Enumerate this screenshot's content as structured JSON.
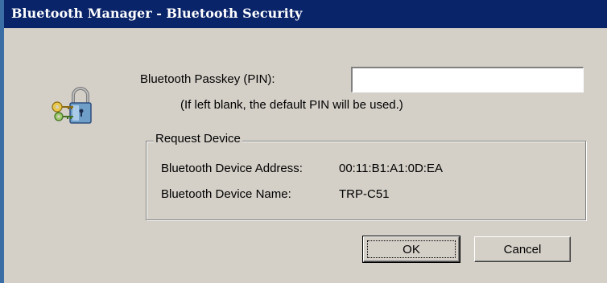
{
  "window": {
    "title": "Bluetooth Manager - Bluetooth Security"
  },
  "passkey": {
    "label": "Bluetooth Passkey (PIN):",
    "value": "",
    "hint": "(If left blank, the default PIN will be used.)"
  },
  "request_device": {
    "group_title": "Request Device",
    "address_label": "Bluetooth Device Address:",
    "address_value": "00:11:B1:A1:0D:EA",
    "name_label": "Bluetooth Device Name:",
    "name_value": "TRP-C51"
  },
  "buttons": {
    "ok_label": "OK",
    "cancel_label": "Cancel"
  },
  "icons": {
    "security": "lock-and-keys-icon"
  },
  "colors": {
    "titlebar": "#0a246a",
    "dialog_bg": "#d4d0c8",
    "desktop_edge": "#3a6ea5"
  }
}
